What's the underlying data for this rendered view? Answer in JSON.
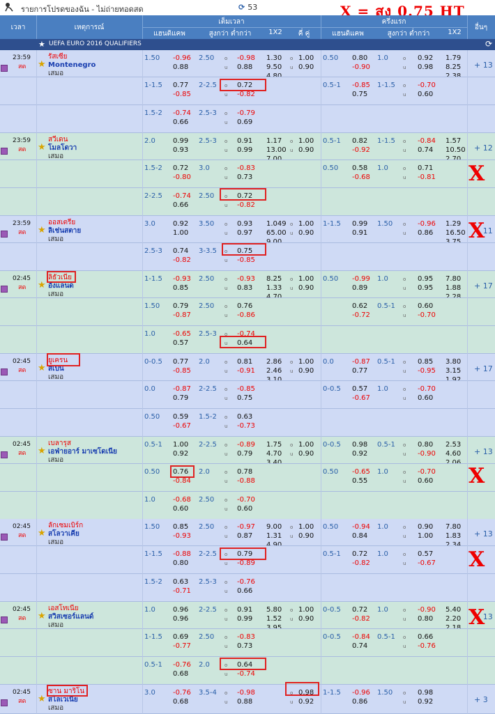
{
  "topbar": {
    "title": "รายการโปรดของฉัน - ไม่ถ่ายทอดสด",
    "refresh_count": "53",
    "note": "X = สูง 0.75 HT"
  },
  "header": {
    "time": "เวลา",
    "event": "เหตุการณ์",
    "fulltime": "เต็มเวลา",
    "firsthalf": "ครึ่งแรก",
    "more": "อื่นๆ",
    "handicap": "แฮนดิแคพ",
    "ou": "สูงกว่า ต่ำกว่า",
    "x12": "1X2",
    "oddeven": "คี่ คู่"
  },
  "league": {
    "name": "UEFA EURO 2016 QUALIFIERS"
  },
  "matches": [
    {
      "time": "23:59",
      "status": "สด",
      "home": "รัสเซีย",
      "away": "Montenegro",
      "draw": "เสมอ",
      "more": "+ 13",
      "lines": [
        [
          "1.50",
          "-0.96",
          "0.88",
          "2.50",
          "-0.98",
          "0.88",
          "1.30",
          "9.50",
          "4.80",
          "1.00",
          "0.90",
          "0.50",
          "0.80",
          "-0.90",
          "1.0",
          "0.92",
          "0.98",
          "1.79",
          "8.25",
          "2.38"
        ],
        [
          "1-1.5",
          "0.77",
          "-0.85",
          "2-2.5",
          "0.72",
          "-0.82",
          "",
          "",
          "",
          "",
          "",
          "0.5-1",
          "-0.85",
          "0.75",
          "1-1.5",
          "-0.70",
          "0.60",
          "",
          "",
          ""
        ],
        [
          "1.5-2",
          "-0.74",
          "0.66",
          "2.5-3",
          "-0.79",
          "0.69",
          "",
          "",
          "",
          "",
          "",
          "",
          "",
          "",
          "",
          "",
          "",
          "",
          "",
          ""
        ]
      ]
    },
    {
      "time": "23:59",
      "status": "สด",
      "home": "สวีเดน",
      "away": "โมลโดวา",
      "draw": "เสมอ",
      "more": "+ 12",
      "lines": [
        [
          "2.0",
          "0.99",
          "0.93",
          "2.5-3",
          "0.91",
          "0.99",
          "1.17",
          "13.00",
          "7.00",
          "1.00",
          "0.90",
          "0.5-1",
          "0.82",
          "-0.92",
          "1-1.5",
          "-0.84",
          "0.74",
          "1.57",
          "10.50",
          "2.70"
        ],
        [
          "1.5-2",
          "0.72",
          "-0.80",
          "3.0",
          "-0.83",
          "0.73",
          "",
          "",
          "",
          "",
          "",
          "0.50",
          "0.58",
          "-0.68",
          "1.0",
          "0.71",
          "-0.81",
          "",
          "",
          ""
        ],
        [
          "2-2.5",
          "-0.74",
          "0.66",
          "2.50",
          "0.72",
          "-0.82",
          "",
          "",
          "",
          "",
          "",
          "",
          "",
          "",
          "",
          "",
          "",
          "",
          "",
          ""
        ]
      ]
    },
    {
      "time": "23:59",
      "status": "สด",
      "home": "ออสเตรีย",
      "away": "ลิเช่นสตาย",
      "draw": "เสมอ",
      "more": "+ 11",
      "lines": [
        [
          "3.0",
          "0.92",
          "1.00",
          "3.50",
          "0.93",
          "0.97",
          "1.049",
          "65.00",
          "9.00",
          "1.00",
          "0.90",
          "1-1.5",
          "0.99",
          "0.91",
          "1.50",
          "-0.96",
          "0.86",
          "1.29",
          "16.50",
          "3.75"
        ],
        [
          "2.5-3",
          "0.74",
          "-0.82",
          "3-3.5",
          "0.75",
          "-0.85",
          "",
          "",
          "",
          "",
          "",
          "",
          "",
          "",
          "",
          "",
          "",
          "",
          "",
          ""
        ]
      ]
    },
    {
      "time": "02:45",
      "status": "สด",
      "home": "ลิธัวเนีย",
      "away": "อังแลนด",
      "draw": "เสมอ",
      "more": "+ 17",
      "lines": [
        [
          "1-1.5",
          "-0.93",
          "0.85",
          "2.50",
          "-0.93",
          "0.83",
          "8.25",
          "1.33",
          "4.70",
          "1.00",
          "0.90",
          "0.50",
          "-0.99",
          "0.89",
          "1.0",
          "0.95",
          "0.95",
          "7.80",
          "1.88",
          "2.28"
        ],
        [
          "1.50",
          "0.79",
          "-0.87",
          "2.50",
          "0.76",
          "-0.86",
          "",
          "",
          "",
          "",
          "",
          "",
          "0.62",
          "-0.72",
          "0.5-1",
          "0.60",
          "-0.70",
          "",
          "",
          ""
        ],
        [
          "1.0",
          "-0.65",
          "0.57",
          "2.5-3",
          "-0.74",
          "0.64",
          "",
          "",
          "",
          "",
          "",
          "",
          "",
          "",
          "",
          "",
          "",
          "",
          "",
          ""
        ]
      ]
    },
    {
      "time": "02:45",
      "status": "สด",
      "home": "ยูเครน",
      "away": "สเปน",
      "draw": "เสมอ",
      "more": "+ 17",
      "lines": [
        [
          "0-0.5",
          "0.77",
          "-0.85",
          "2.0",
          "0.81",
          "-0.91",
          "2.86",
          "2.46",
          "3.10",
          "1.00",
          "0.90",
          "0.0",
          "-0.87",
          "0.77",
          "0.5-1",
          "0.85",
          "-0.95",
          "3.80",
          "3.15",
          "1.92"
        ],
        [
          "0.0",
          "-0.87",
          "0.79",
          "2-2.5",
          "-0.85",
          "0.75",
          "",
          "",
          "",
          "",
          "",
          "0-0.5",
          "0.57",
          "-0.67",
          "1.0",
          "-0.70",
          "0.60",
          "",
          "",
          ""
        ],
        [
          "0.50",
          "0.59",
          "-0.67",
          "1.5-2",
          "0.63",
          "-0.73",
          "",
          "",
          "",
          "",
          "",
          "",
          "",
          "",
          "",
          "",
          "",
          "",
          "",
          ""
        ]
      ]
    },
    {
      "time": "02:45",
      "status": "สด",
      "home": "เบลารุส",
      "away": "เอฟ่ายอาร์ มาเซโดเนีย",
      "draw": "เสมอ",
      "more": "+ 13",
      "lines": [
        [
          "0.5-1",
          "1.00",
          "0.92",
          "2-2.5",
          "-0.89",
          "0.79",
          "1.75",
          "4.70",
          "3.40",
          "1.00",
          "0.90",
          "0-0.5",
          "0.98",
          "0.92",
          "0.5-1",
          "0.80",
          "-0.90",
          "2.53",
          "4.60",
          "2.06"
        ],
        [
          "0.50",
          "0.76",
          "-0.84",
          "2.0",
          "0.78",
          "-0.88",
          "",
          "",
          "",
          "",
          "",
          "0.50",
          "-0.65",
          "0.55",
          "1.0",
          "-0.70",
          "0.60",
          "",
          "",
          ""
        ],
        [
          "1.0",
          "-0.68",
          "0.60",
          "2.50",
          "-0.70",
          "0.60",
          "",
          "",
          "",
          "",
          "",
          "",
          "",
          "",
          "",
          "",
          "",
          "",
          "",
          ""
        ]
      ]
    },
    {
      "time": "02:45",
      "status": "สด",
      "home": "ลักเซมเบิร์ก",
      "away": "สโลวาเคีย",
      "draw": "เสมอ",
      "more": "+ 13",
      "lines": [
        [
          "1.50",
          "0.85",
          "-0.93",
          "2.50",
          "-0.97",
          "0.87",
          "9.00",
          "1.31",
          "4.90",
          "1.00",
          "0.90",
          "0.50",
          "-0.94",
          "0.84",
          "1.0",
          "0.90",
          "1.00",
          "7.80",
          "1.83",
          "2.34"
        ],
        [
          "1-1.5",
          "-0.88",
          "0.80",
          "2-2.5",
          "0.79",
          "-0.89",
          "",
          "",
          "",
          "",
          "",
          "0.5-1",
          "0.72",
          "-0.82",
          "1.0",
          "0.57",
          "-0.67",
          "",
          "",
          ""
        ],
        [
          "1.5-2",
          "0.63",
          "-0.71",
          "2.5-3",
          "-0.76",
          "0.66",
          "",
          "",
          "",
          "",
          "",
          "",
          "",
          "",
          "",
          "",
          "",
          "",
          "",
          ""
        ]
      ]
    },
    {
      "time": "02:45",
      "status": "สด",
      "home": "เอสโทเนีย",
      "away": "สวิสเซอร์แลนด์",
      "draw": "เสมอ",
      "more": "+ 13",
      "lines": [
        [
          "1.0",
          "0.96",
          "0.96",
          "2-2.5",
          "0.91",
          "0.99",
          "5.80",
          "1.52",
          "3.95",
          "1.00",
          "0.90",
          "0-0.5",
          "0.72",
          "-0.82",
          "1.0",
          "-0.90",
          "0.80",
          "5.40",
          "2.20",
          "2.18"
        ],
        [
          "1-1.5",
          "0.69",
          "-0.77",
          "2.50",
          "-0.83",
          "0.73",
          "",
          "",
          "",
          "",
          "",
          "0-0.5",
          "-0.84",
          "0.74",
          "0.5-1",
          "0.66",
          "-0.76",
          "",
          "",
          ""
        ],
        [
          "0.5-1",
          "-0.76",
          "0.68",
          "2.0",
          "0.64",
          "-0.74",
          "",
          "",
          "",
          "",
          "",
          "",
          "",
          "",
          "",
          "",
          "",
          "",
          "",
          ""
        ]
      ]
    },
    {
      "time": "02:45",
      "status": "สด",
      "home": "ซาน มาริโน",
      "away": "สโลเวเนีย",
      "draw": "เสมอ",
      "more": "+ 3",
      "lines": [
        [
          "3.0",
          "-0.76",
          "0.68",
          "3.5-4",
          "-0.98",
          "0.88",
          "",
          "",
          "",
          "0.98",
          "0.92",
          "1-1.5",
          "-0.96",
          "0.86",
          "1.50",
          "0.98",
          "0.92",
          "",
          "",
          ""
        ]
      ]
    }
  ],
  "big_x": "X"
}
